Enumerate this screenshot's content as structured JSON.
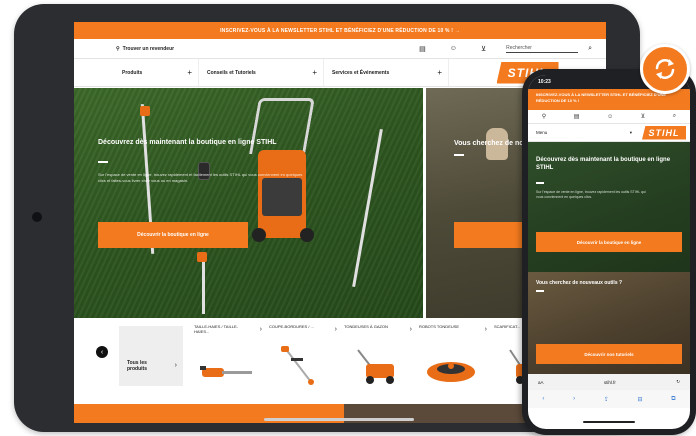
{
  "tablet": {
    "promo": "INSCRIVEZ-VOUS À LA NEWSLETTER STIHL ET BÉNÉFICIEZ D'UNE RÉDUCTION DE 10 % ! →",
    "store_finder": "Trouver un revendeur",
    "search_placeholder": "Rechercher",
    "nav": [
      {
        "label": "Produits"
      },
      {
        "label": "Conseils et Tutoriels"
      },
      {
        "label": "Services et Événements"
      }
    ],
    "logo": "STIHL",
    "hero_left": {
      "title": "Découvrez dès maintenant la boutique en ligne STIHL",
      "text": "Sur l'espace de vente en ligne, trouvez rapidement et facilement les outils STIHL qui vous conviennent en quelques clics et faites-vous livrer chez vous ou en magasin.",
      "button": "Découvrir la boutique en ligne"
    },
    "hero_right": {
      "title": "Vous cherchez de nouveaux",
      "button": "Découvrir leur"
    },
    "categories_all": "Tous les produits",
    "categories": [
      {
        "name": "Taille-haies / Taille-haies..."
      },
      {
        "name": "Coupe-bordures / ..."
      },
      {
        "name": "Tondeuses à gazon"
      },
      {
        "name": "Robots tondeuse"
      },
      {
        "name": "Scarificat..."
      }
    ]
  },
  "phone": {
    "time": "10:23",
    "promo": "INSCRIVEZ-VOUS À LA NEWSLETTER STIHL ET BÉNÉFICIEZ D'UNE RÉDUCTION DE 10 % !",
    "menu": "Menu",
    "logo": "STIHL",
    "hero": {
      "title": "Découvrez dès maintenant la boutique en ligne STIHL",
      "text": "Sur l'espace de vente en ligne, trouvez rapidement les outils STIHL qui vous conviennent en quelques clics.",
      "button": "Découvrir la boutique en ligne"
    },
    "hero2": {
      "title": "Vous cherchez de nouveaux outils ?",
      "button": "Découvrir nos tutoriels"
    },
    "url_left": "aA",
    "url": "stihl.fr",
    "url_right": "↻"
  },
  "colors": {
    "accent": "#f37a1f",
    "device": "#2b2d31"
  },
  "icons": [
    "location-pin-icon",
    "store-icon",
    "account-icon",
    "cart-icon",
    "search-icon",
    "plus-icon",
    "chevron-right-icon",
    "arrow-left-icon",
    "sync-icon"
  ]
}
